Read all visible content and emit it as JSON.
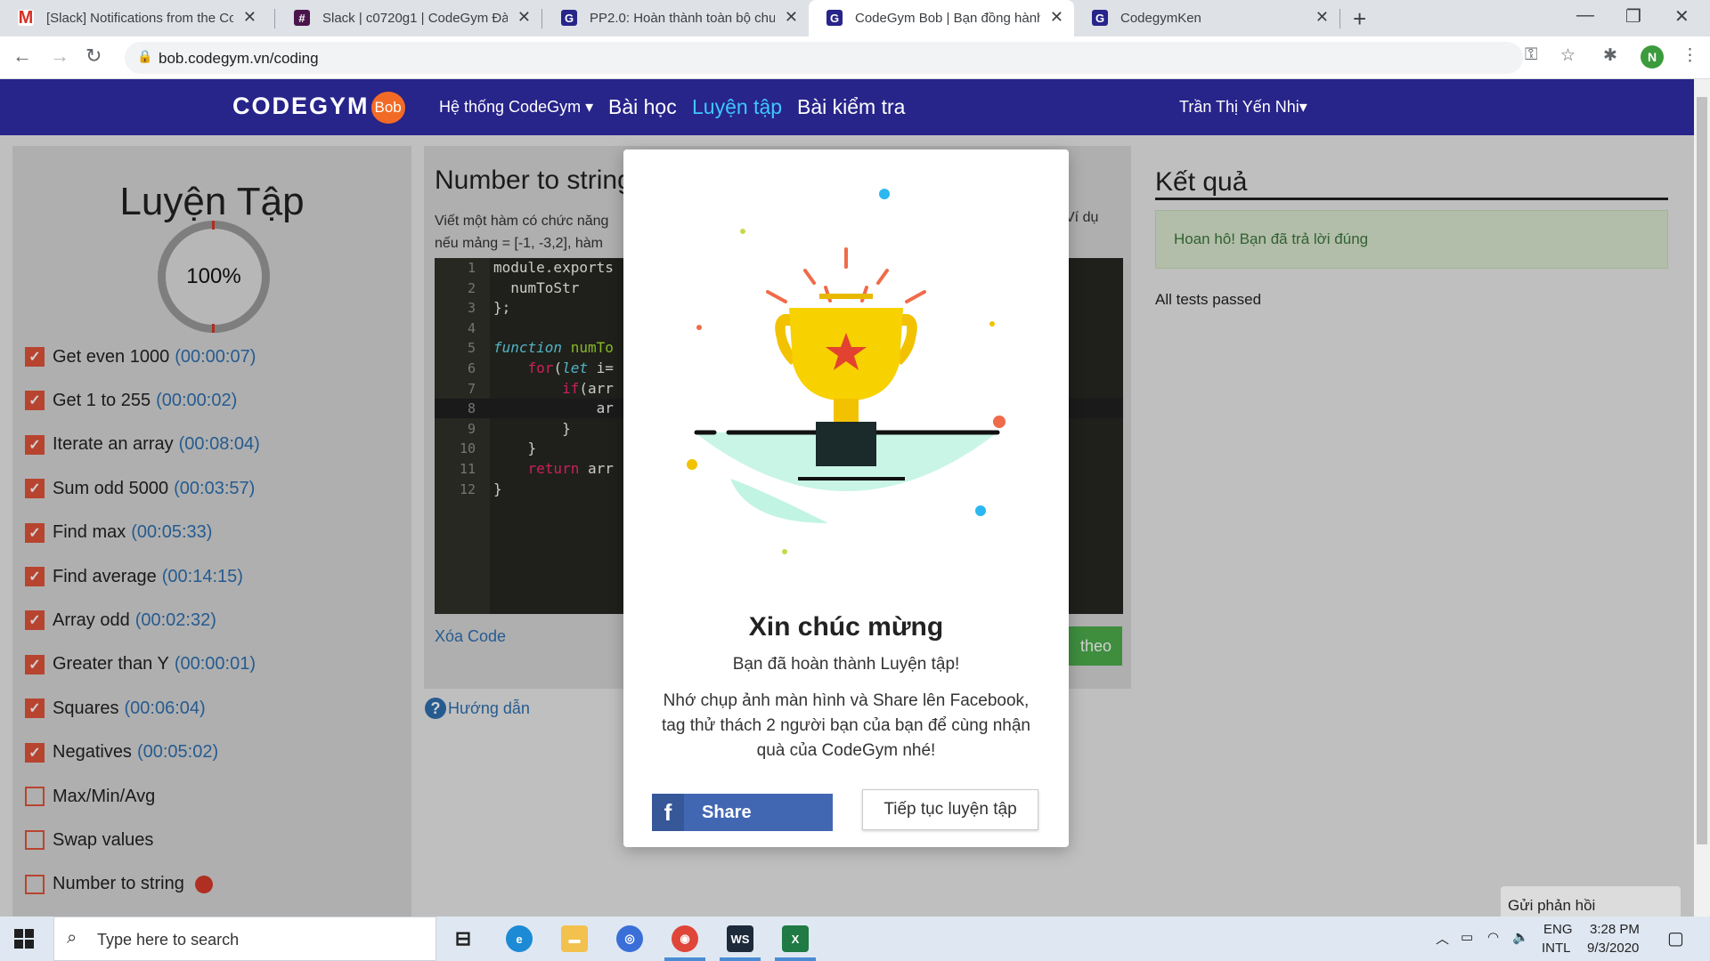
{
  "browser": {
    "tabs": [
      {
        "title": "[Slack] Notifications from the Co",
        "favicon": "gmail-icon",
        "color": "#d93025"
      },
      {
        "title": "Slack | c0720g1 | CodeGym Đà N",
        "favicon": "slack-icon",
        "color": "#4a154b"
      },
      {
        "title": "PP2.0: Hoàn thành toàn bộ chươ",
        "favicon": "codegym-icon",
        "color": "#27248a"
      },
      {
        "title": "CodeGym Bob | Bạn đồng hành c",
        "favicon": "codegym-icon",
        "color": "#27248a"
      },
      {
        "title": "CodegymKen",
        "favicon": "codegym-icon",
        "color": "#27248a"
      }
    ],
    "url": "bob.codegym.vn/coding",
    "profile_initial": "N"
  },
  "site_nav": {
    "logo": "CODEGYM",
    "logo_badge": "Bob",
    "system_menu": "Hệ thống CodeGym ▾",
    "lessons": "Bài học",
    "practice": "Luyện tập",
    "tests": "Bài kiểm tra",
    "user": "Trần Thị Yến Nhi▾"
  },
  "left_panel": {
    "title": "Luyện Tập",
    "progress_label": "100%",
    "exercises": [
      {
        "name": "Get even 1000",
        "time": "(00:00:07)",
        "done": true
      },
      {
        "name": "Get 1 to 255",
        "time": "(00:00:02)",
        "done": true
      },
      {
        "name": "Iterate an array",
        "time": "(00:08:04)",
        "done": true
      },
      {
        "name": "Sum odd 5000",
        "time": "(00:03:57)",
        "done": true
      },
      {
        "name": "Find max",
        "time": "(00:05:33)",
        "done": true
      },
      {
        "name": "Find average",
        "time": "(00:14:15)",
        "done": true
      },
      {
        "name": "Array odd",
        "time": "(00:02:32)",
        "done": true
      },
      {
        "name": "Greater than Y",
        "time": "(00:00:01)",
        "done": true
      },
      {
        "name": "Squares",
        "time": "(00:06:04)",
        "done": true
      },
      {
        "name": "Negatives",
        "time": "(00:05:02)",
        "done": true
      },
      {
        "name": "Max/Min/Avg",
        "time": "",
        "done": false
      },
      {
        "name": "Swap values",
        "time": "",
        "done": false
      },
      {
        "name": "Number to string",
        "time": "",
        "done": false
      }
    ]
  },
  "middle_panel": {
    "title": "Number to string",
    "desc_line1": "Viết một hàm có chức năng",
    "desc_line2": "nếu mảng = [-1, -3,2], hàm",
    "desc_tail": "Ví dụ",
    "code_lines": [
      {
        "n": "1",
        "text": "module.exports"
      },
      {
        "n": "2",
        "text": "  numToStr"
      },
      {
        "n": "3",
        "text": "};"
      },
      {
        "n": "4",
        "text": ""
      },
      {
        "n": "5",
        "text": "function numTo"
      },
      {
        "n": "6",
        "text": "    for(let i="
      },
      {
        "n": "7",
        "text": "        if(arr"
      },
      {
        "n": "8",
        "text": "            ar"
      },
      {
        "n": "9",
        "text": "        }"
      },
      {
        "n": "10",
        "text": "    }"
      },
      {
        "n": "11",
        "text": "    return arr"
      },
      {
        "n": "12",
        "text": "}"
      }
    ],
    "clear_code": "Xóa Code",
    "next_label": "theo",
    "help": "Hướng dẫn"
  },
  "right_panel": {
    "title": "Kết quả",
    "success": "Hoan hô! Bạn đã trả lời đúng",
    "tests": "All tests passed",
    "feedback": "Gửi phản hồi"
  },
  "modal": {
    "illustration": "trophy-icon",
    "title": "Xin chúc mừng",
    "subtitle": "Bạn đã hoàn thành Luyện tập!",
    "message": "Nhớ chụp ảnh màn hình và Share lên Facebook, tag thử thách 2 người bạn của bạn để cùng nhận quà của CodeGym nhé!",
    "share_label": "Share",
    "continue_label": "Tiếp tục luyện tập"
  },
  "taskbar": {
    "search_placeholder": "Type here to search",
    "lang1": "ENG",
    "lang2": "INTL",
    "time": "3:28 PM",
    "date": "9/3/2020"
  },
  "colors": {
    "nav_bg": "#27248a",
    "nav_active": "#3ec7ff",
    "accent_orange": "#e0533a",
    "success_text": "#3c763d",
    "facebook": "#4267b2"
  }
}
